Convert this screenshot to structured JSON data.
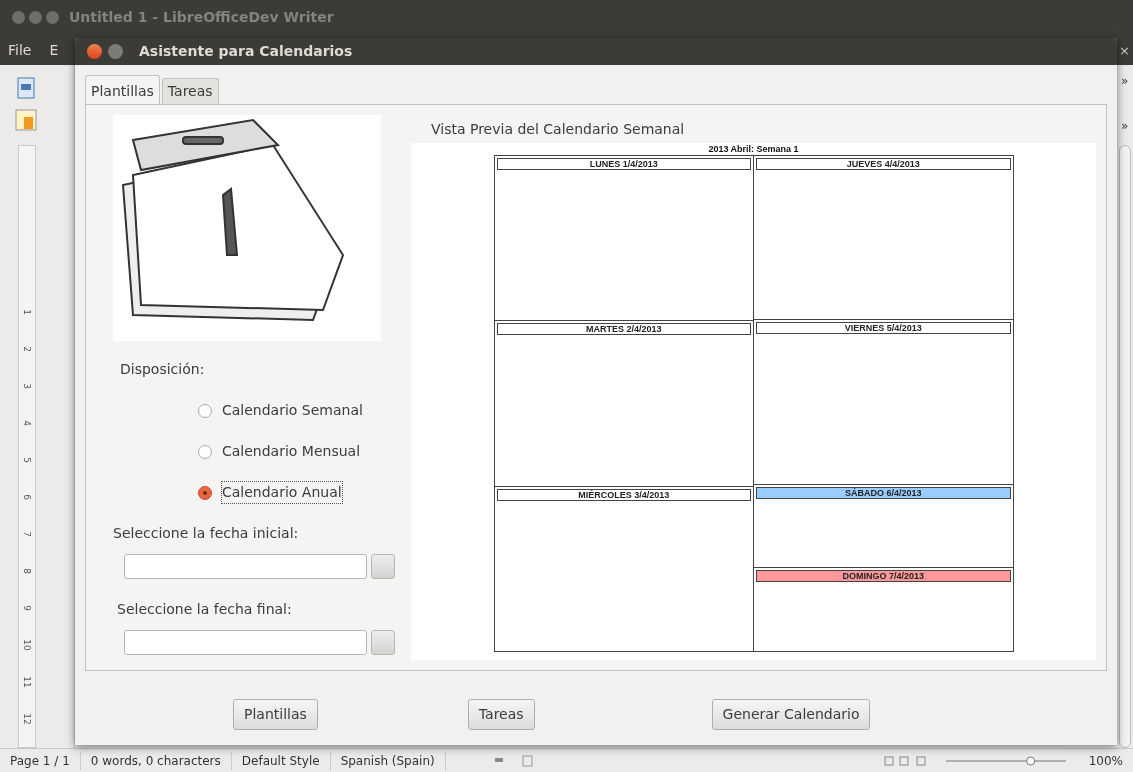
{
  "app_window": {
    "title": "Untitled 1 - LibreOfficeDev Writer",
    "menu": [
      "File",
      "E"
    ],
    "close_glyph": "×",
    "toolbar_overflow": [
      "»",
      "»"
    ],
    "zoom_slider": {
      "level": 0.72
    },
    "ruler_numbers": [
      "1",
      "2",
      "3",
      "4",
      "5",
      "6",
      "7",
      "8",
      "9",
      "10",
      "11",
      "12"
    ]
  },
  "dialog": {
    "title": "Asistente para Calendarios",
    "tabs": [
      {
        "label": "Plantillas",
        "selected": true
      },
      {
        "label": "Tareas",
        "selected": false
      }
    ],
    "layout_label": "Disposición:",
    "layout_options": [
      {
        "label": "Calendario Semanal",
        "selected": false
      },
      {
        "label": "Calendario Mensual",
        "selected": false
      },
      {
        "label": "Calendario Anual",
        "selected": true
      }
    ],
    "start_date_label": "Seleccione la fecha inicial:",
    "end_date_label": "Seleccione la fecha final:",
    "preview": {
      "heading": "Vista Previa del Calendario Semanal",
      "calendar_title": "2013 Abril: Semana 1",
      "columns": [
        [
          {
            "day": "LUNES 1/4/2013",
            "kind": "weekday",
            "color": "#ffffff"
          },
          {
            "day": "MARTES 2/4/2013",
            "kind": "weekday",
            "color": "#ffffff"
          },
          {
            "day": "MIÉRCOLES 3/4/2013",
            "kind": "weekday",
            "color": "#ffffff"
          }
        ],
        [
          {
            "day": "JUEVES 4/4/2013",
            "kind": "weekday",
            "color": "#ffffff"
          },
          {
            "day": "VIERNES 5/4/2013",
            "kind": "weekday",
            "color": "#ffffff"
          },
          {
            "day": "SÁBADO 6/4/2013",
            "kind": "weekend",
            "color": "#99ccff"
          },
          {
            "day": "DOMINGO 7/4/2013",
            "kind": "weekend",
            "color": "#ff9999"
          }
        ]
      ]
    },
    "buttons": [
      "Plantillas",
      "Tareas",
      "Generar Calendario"
    ]
  },
  "status_bar": [
    "Page 1 / 1",
    "0 words, 0 characters",
    "Default Style",
    "Spanish (Spain)",
    "100%"
  ]
}
